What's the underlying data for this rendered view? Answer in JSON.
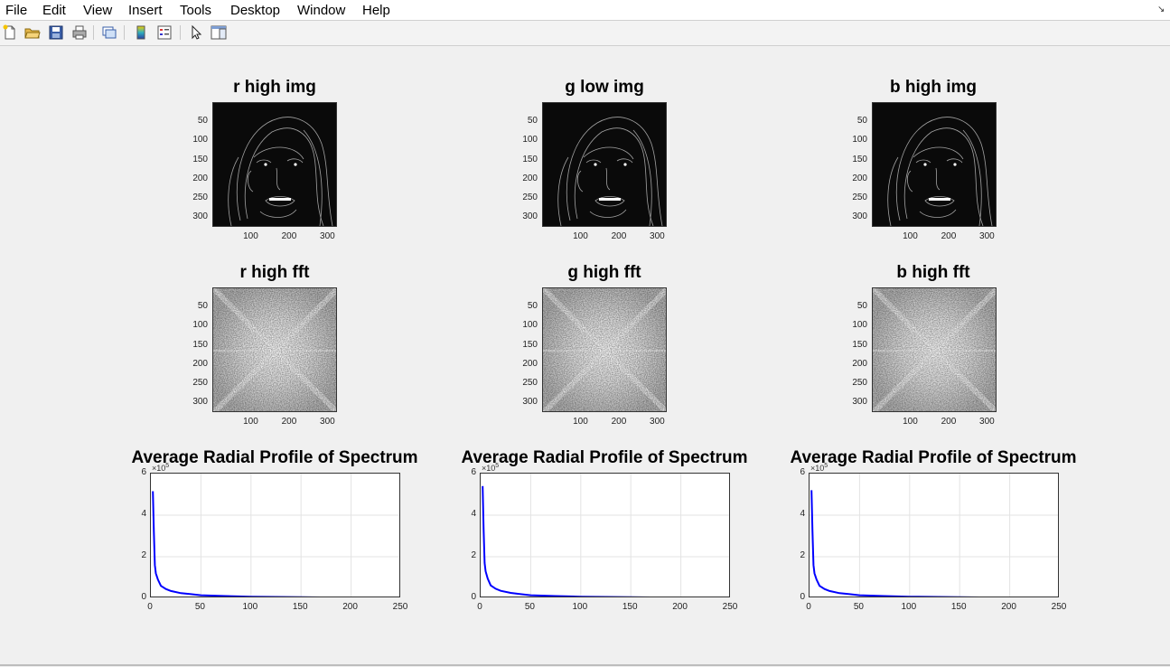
{
  "menu": [
    "File",
    "Edit",
    "View",
    "Insert",
    "Tools",
    "Desktop",
    "Window",
    "Help"
  ],
  "toolbar": {
    "icons": [
      "new-figure-icon",
      "open-file-icon",
      "save-icon",
      "print-icon",
      "link-icon",
      "colorbar-icon",
      "legend-icon",
      "pointer-icon",
      "property-inspector-icon"
    ]
  },
  "rows": {
    "img": {
      "titles": [
        "r high img",
        "g low img",
        "b high img"
      ],
      "yticks": [
        "50",
        "100",
        "150",
        "200",
        "250",
        "300"
      ],
      "xticks": [
        "100",
        "200",
        "300"
      ]
    },
    "fft": {
      "titles": [
        "r high fft",
        "g high fft",
        "b high fft"
      ],
      "yticks": [
        "50",
        "100",
        "150",
        "200",
        "250",
        "300"
      ],
      "xticks": [
        "100",
        "200",
        "300"
      ]
    },
    "profile": {
      "titles": [
        "Average Radial Profile of Spectrum",
        "Average Radial Profile of Spectrum",
        "Average Radial Profile of Spectrum"
      ],
      "yticks": [
        "6",
        "4",
        "2",
        "0"
      ],
      "xticks": [
        "0",
        "50",
        "100",
        "150",
        "200",
        "250"
      ],
      "exponent_base": "×10",
      "exponent_power": "5"
    }
  },
  "colors": {
    "line": "#0000ff",
    "figure_bg": "#f0f0f0"
  },
  "chart_data": [
    {
      "type": "line",
      "title": "Average Radial Profile of Spectrum",
      "xlim": [
        0,
        250
      ],
      "ylim": [
        0,
        6
      ],
      "y_scale_note": "×10^5",
      "grid": true,
      "series": [
        {
          "x": [
            2,
            3,
            4,
            5,
            7,
            10,
            15,
            20,
            30,
            40,
            50,
            75,
            100,
            150,
            200,
            230
          ],
          "y": [
            5.15,
            3.2,
            1.6,
            1.2,
            0.9,
            0.6,
            0.45,
            0.35,
            0.25,
            0.2,
            0.15,
            0.11,
            0.08,
            0.05,
            0.03,
            0.02
          ]
        }
      ]
    },
    {
      "type": "line",
      "title": "Average Radial Profile of Spectrum",
      "xlim": [
        0,
        250
      ],
      "ylim": [
        0,
        6
      ],
      "y_scale_note": "×10^5",
      "grid": true,
      "series": [
        {
          "x": [
            2,
            3,
            4,
            5,
            7,
            10,
            15,
            20,
            30,
            40,
            50,
            75,
            100,
            150,
            200,
            230
          ],
          "y": [
            5.4,
            3.3,
            1.7,
            1.3,
            0.95,
            0.62,
            0.46,
            0.36,
            0.26,
            0.2,
            0.15,
            0.11,
            0.08,
            0.05,
            0.03,
            0.02
          ]
        }
      ]
    },
    {
      "type": "line",
      "title": "Average Radial Profile of Spectrum",
      "xlim": [
        0,
        250
      ],
      "ylim": [
        0,
        6
      ],
      "y_scale_note": "×10^5",
      "grid": true,
      "series": [
        {
          "x": [
            2,
            3,
            4,
            5,
            7,
            10,
            15,
            20,
            30,
            40,
            50,
            75,
            100,
            150,
            200,
            230
          ],
          "y": [
            5.2,
            3.2,
            1.6,
            1.2,
            0.9,
            0.6,
            0.45,
            0.35,
            0.25,
            0.2,
            0.15,
            0.11,
            0.08,
            0.05,
            0.03,
            0.02
          ]
        }
      ]
    }
  ]
}
